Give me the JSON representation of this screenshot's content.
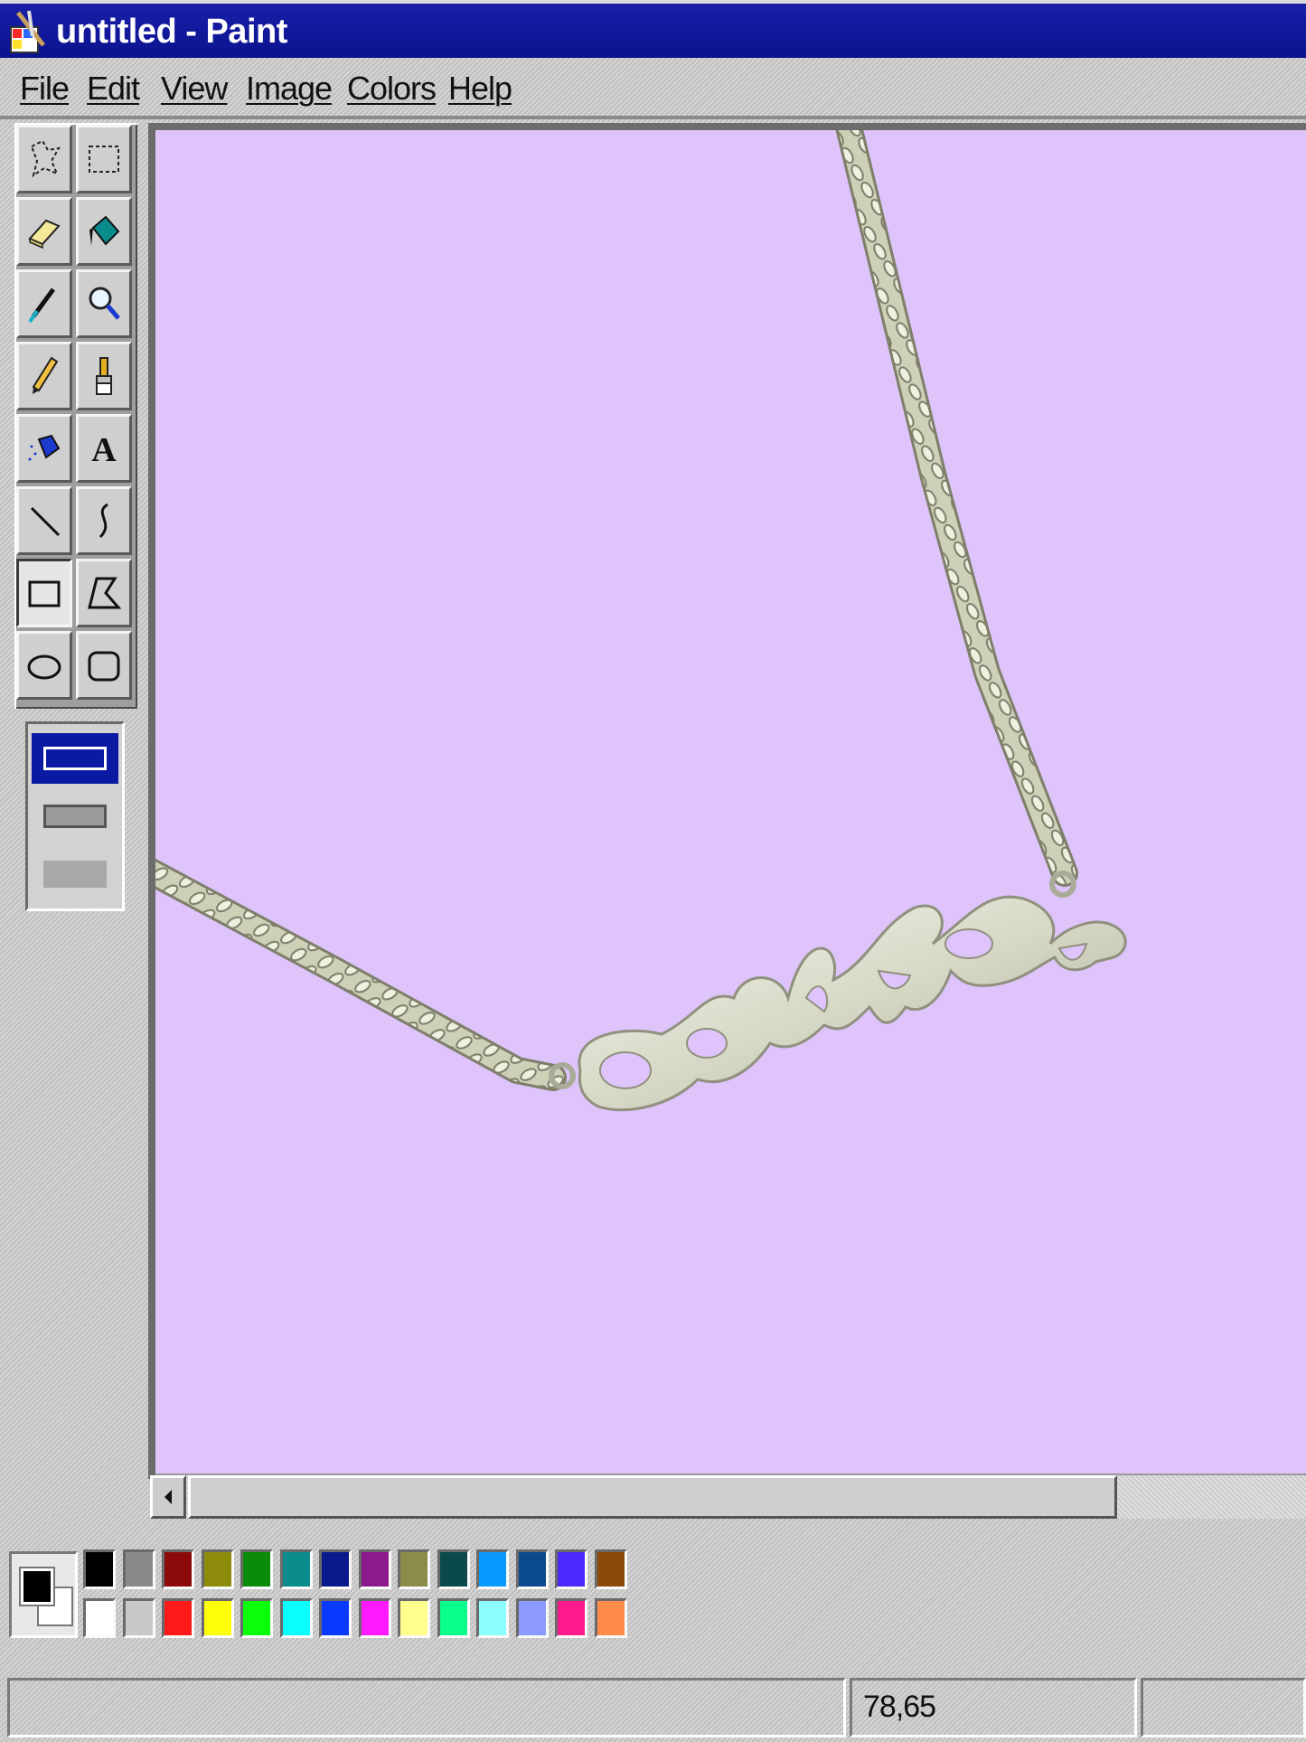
{
  "window": {
    "title": "untitled - Paint"
  },
  "menu": [
    {
      "label": "File"
    },
    {
      "label": "Edit"
    },
    {
      "label": "View"
    },
    {
      "label": "Image"
    },
    {
      "label": "Colors"
    },
    {
      "label": "Help"
    }
  ],
  "tools": [
    {
      "name": "free-form-select"
    },
    {
      "name": "rect-select"
    },
    {
      "name": "eraser"
    },
    {
      "name": "fill-bucket"
    },
    {
      "name": "eyedropper"
    },
    {
      "name": "magnifier"
    },
    {
      "name": "pencil"
    },
    {
      "name": "brush"
    },
    {
      "name": "airbrush"
    },
    {
      "name": "text"
    },
    {
      "name": "line"
    },
    {
      "name": "curve"
    },
    {
      "name": "rectangle",
      "selected": true
    },
    {
      "name": "polygon"
    },
    {
      "name": "ellipse"
    },
    {
      "name": "rounded-rectangle"
    }
  ],
  "canvas": {
    "background": "#dec4fa",
    "image": "silver curb chain necklace with cut-out nameplate pendant"
  },
  "palette": {
    "foreground": "#000000",
    "background": "#ffffff",
    "top_row": [
      "#000000",
      "#8a8a8a",
      "#8c0a0a",
      "#8c8c0a",
      "#0a8c0a",
      "#0a8c8c",
      "#0a1a8c",
      "#8c1a8c",
      "#8c8c4a",
      "#0a4a4a",
      "#0a9aff",
      "#0a4a8c",
      "#4a2aff",
      "#8c4a0a"
    ],
    "bottom_row": [
      "#ffffff",
      "#c8c8c8",
      "#ff1a1a",
      "#ffff0a",
      "#0aff0a",
      "#0affff",
      "#0a3aff",
      "#ff1aff",
      "#ffff8c",
      "#0aff8c",
      "#8cffff",
      "#8c9aff",
      "#ff1a8c",
      "#ff8c4a"
    ]
  },
  "status": {
    "message": "",
    "coordinates": "78,65",
    "size": ""
  }
}
